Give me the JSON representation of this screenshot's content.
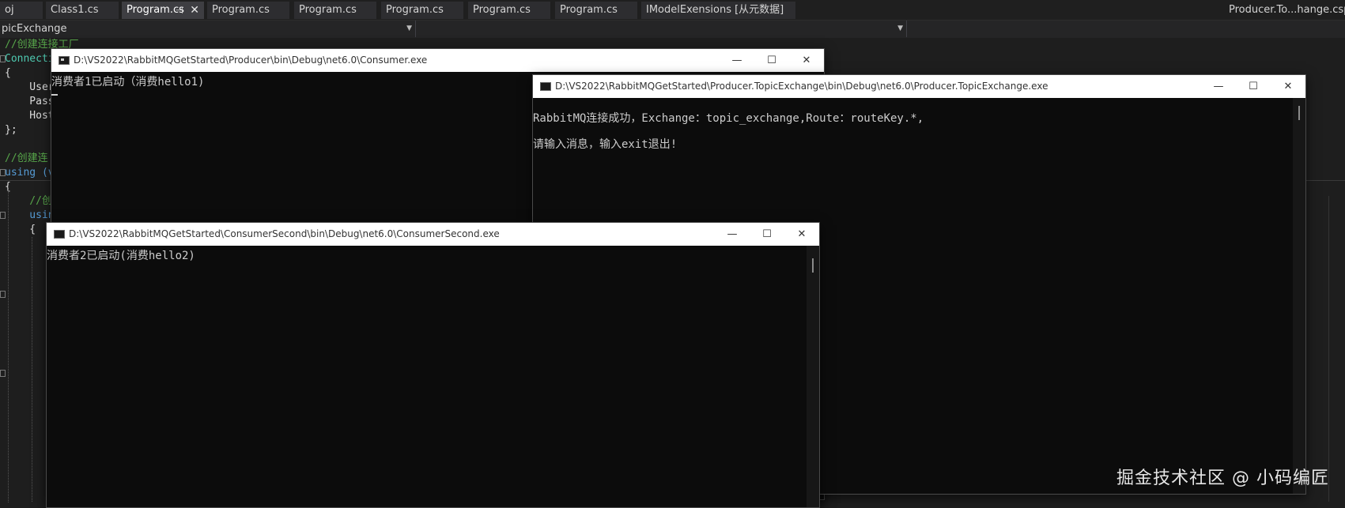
{
  "ide": {
    "tabs": [
      {
        "label": "oj"
      },
      {
        "label": "Class1.cs"
      },
      {
        "label": "Program.cs",
        "pin": "⊣",
        "close": "✕"
      },
      {
        "label": "Program.cs"
      },
      {
        "label": "Program.cs"
      },
      {
        "label": "Program.cs"
      },
      {
        "label": "Program.cs"
      },
      {
        "label": "Program.cs"
      },
      {
        "label": "IModelExensions [从元数据]"
      },
      {
        "label": "Producer.To...hange.csproj"
      }
    ],
    "nav": {
      "project_combo": "picExchange",
      "member_combo": ""
    },
    "code_lines": [
      "//创建连接工厂",
      "Connecti",
      "{",
      "    User",
      "    Pass",
      "    Host",
      "};",
      "",
      "//创建连",
      "using (v",
      "{",
      "    //创",
      "    usin",
      "    {"
    ]
  },
  "windows": {
    "consumer1": {
      "title": "D:\\VS2022\\RabbitMQGetStarted\\Producer\\bin\\Debug\\net6.0\\Consumer.exe",
      "icon": "cmd-icon",
      "lines": [
        "消费者1已启动（消费hello1)"
      ]
    },
    "producer": {
      "title": "D:\\VS2022\\RabbitMQGetStarted\\Producer.TopicExchange\\bin\\Debug\\net6.0\\Producer.TopicExchange.exe",
      "icon": "console-icon",
      "lines": [
        "RabbitMQ连接成功，Exchange：topic_exchange,Route：routeKey.*,",
        "请输入消息，输入exit退出!"
      ]
    },
    "consumer2": {
      "title": "D:\\VS2022\\RabbitMQGetStarted\\ConsumerSecond\\bin\\Debug\\net6.0\\ConsumerSecond.exe",
      "icon": "console-icon",
      "lines": [
        "消费者2已启动(消费hello2)"
      ]
    },
    "buttons": {
      "minimize": "—",
      "maximize": "☐",
      "close": "✕"
    }
  },
  "watermark": "掘金技术社区 @ 小码编匠"
}
